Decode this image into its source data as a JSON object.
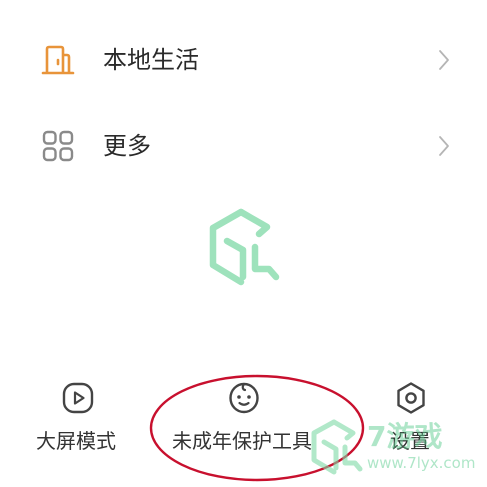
{
  "menu": {
    "items": [
      {
        "label": "本地生活",
        "icon": "door-icon",
        "icon_color": "#E8943A"
      },
      {
        "label": "更多",
        "icon": "grid-icon",
        "icon_color": "#8A8A8A"
      }
    ]
  },
  "bottom_bar": {
    "items": [
      {
        "label": "大屏模式",
        "icon": "play-icon"
      },
      {
        "label": "未成年保护工具",
        "icon": "baby-face-icon"
      },
      {
        "label": "设置",
        "icon": "settings-icon"
      }
    ]
  },
  "watermark": {
    "brand": "7游戏",
    "url": "www.7lyx.com",
    "color": "#5FCD91"
  },
  "highlight_color": "#C8102E"
}
